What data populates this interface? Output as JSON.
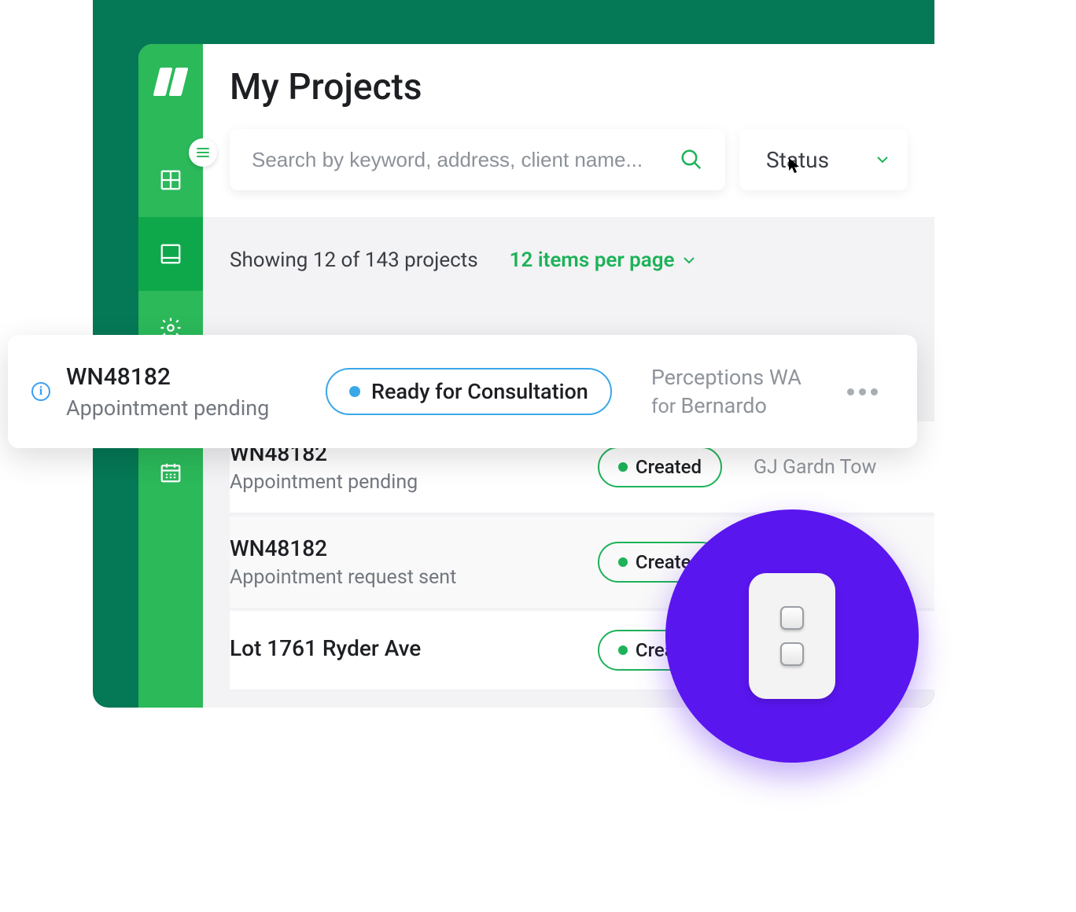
{
  "header": {
    "title": "My Projects"
  },
  "search": {
    "placeholder": "Search by keyword, address, client name..."
  },
  "filter": {
    "status_label": "Status"
  },
  "summary": {
    "text": "Showing 12 of 143 projects",
    "per_page": "12 items per page"
  },
  "floating_card": {
    "id": "WN48182",
    "subtitle": "Appointment pending",
    "status": "Ready for Consultation",
    "client_line1": "Perceptions WA",
    "client_for": "for",
    "client_name": "Bernardo"
  },
  "projects": [
    {
      "id": "WN48182",
      "subtitle": "Appointment pending",
      "status": "Created",
      "client": "GJ Gardn Tow"
    },
    {
      "id": "WN48182",
      "subtitle": "Appointment request sent",
      "status": "Created",
      "client": ""
    },
    {
      "id": "Lot 1761 Ryder Ave",
      "subtitle": "",
      "status": "Created",
      "client": ""
    }
  ],
  "colors": {
    "brand_green_dark": "#057855",
    "brand_green": "#2bb95a",
    "brand_green_active": "#0ea84b",
    "accent_green": "#1eb259",
    "accent_blue": "#3aa8e8",
    "fab_purple": "#5a16ef"
  }
}
